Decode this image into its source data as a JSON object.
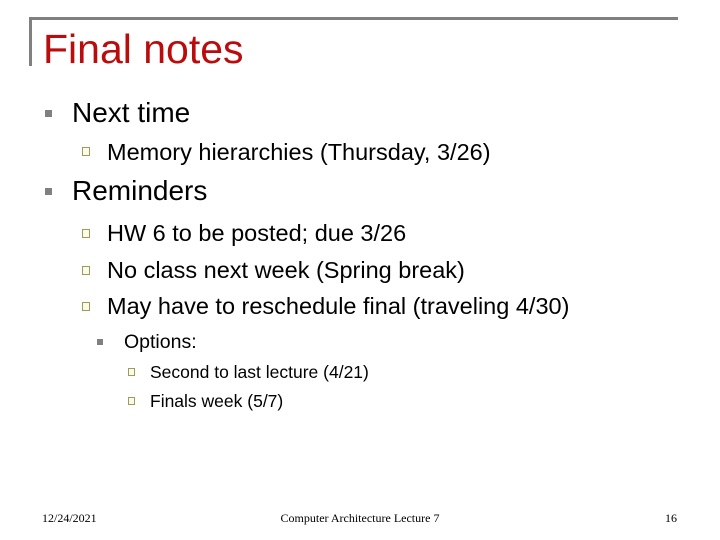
{
  "slide": {
    "title": "Final notes",
    "accent_color": "#BA0C0C",
    "bullets": [
      {
        "level": 1,
        "text": "Next time",
        "children": [
          {
            "level": 2,
            "text": "Memory hierarchies (Thursday, 3/26)"
          }
        ]
      },
      {
        "level": 1,
        "text": "Reminders",
        "children": [
          {
            "level": 2,
            "text": "HW 6 to be posted; due 3/26"
          },
          {
            "level": 2,
            "text": "No class next week (Spring break)"
          },
          {
            "level": 2,
            "text": "May have to reschedule final (traveling 4/30)",
            "children": [
              {
                "level": 3,
                "text": "Options:",
                "children": [
                  {
                    "level": 4,
                    "text": "Second to last lecture (4/21)"
                  },
                  {
                    "level": 4,
                    "text": "Finals week (5/7)"
                  }
                ]
              }
            ]
          }
        ]
      }
    ],
    "bullet_icons": {
      "level1": "filled-square-bullet",
      "level2": "hollow-square-bullet",
      "level3": "filled-square-bullet",
      "level4": "hollow-square-bullet"
    }
  },
  "footer": {
    "date": "12/24/2021",
    "center": "Computer Architecture Lecture 7",
    "page_number": "16"
  }
}
